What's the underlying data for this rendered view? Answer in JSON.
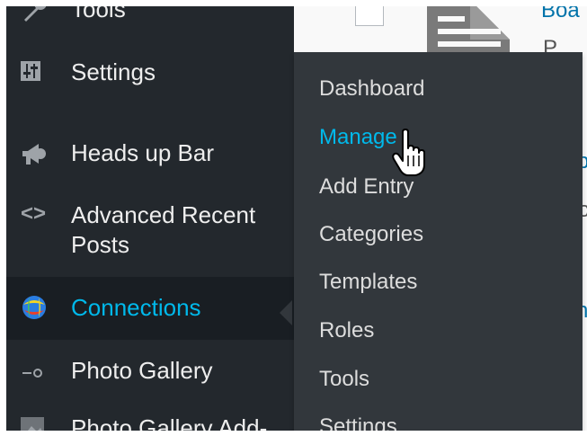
{
  "sidebar": {
    "items": [
      {
        "label": "Tools",
        "icon": "wrench-icon"
      },
      {
        "label": "Settings",
        "icon": "settings-sliders-icon"
      },
      {
        "label": "Heads up Bar",
        "icon": "megaphone-icon"
      },
      {
        "label": "Advanced Recent Posts",
        "icon": "code-brackets-icon"
      },
      {
        "label": "Connections",
        "icon": "connections-logo-icon",
        "current": true
      },
      {
        "label": "Photo Gallery",
        "icon": "photo-gallery-icon"
      },
      {
        "label": "Photo Gallery Add-",
        "icon": "photo-gallery-addons-icon"
      }
    ]
  },
  "flyout": {
    "items": [
      {
        "label": "Dashboard"
      },
      {
        "label": "Manage",
        "hovered": true
      },
      {
        "label": "Add Entry"
      },
      {
        "label": "Categories"
      },
      {
        "label": "Templates"
      },
      {
        "label": "Roles"
      },
      {
        "label": "Tools"
      },
      {
        "label": "Settings"
      }
    ]
  },
  "content": {
    "title_fragment": "Boa",
    "text_fragment": "P",
    "side_fragments": [
      "p",
      "o",
      "n"
    ]
  },
  "colors": {
    "sidebar_bg": "#23282d",
    "submenu_bg": "#32373c",
    "accent": "#00b9eb",
    "link": "#0073aa"
  }
}
